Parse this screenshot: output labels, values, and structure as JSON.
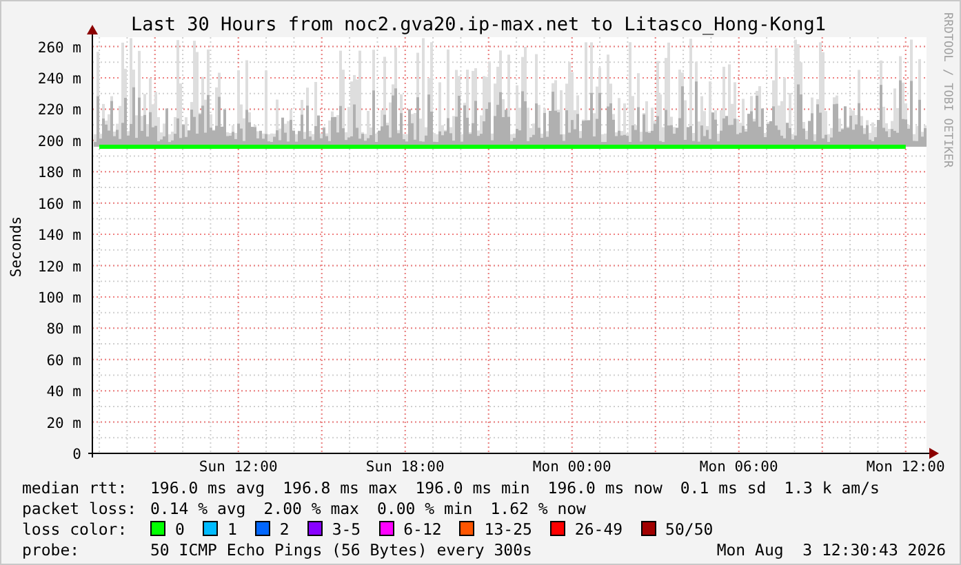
{
  "chart": {
    "title": "Last 30 Hours from noc2.gva20.ip-max.net to Litasco_Hong-Kong1",
    "watermark": "RRDTOOL / TOBI OETIKER",
    "chart_data": {
      "type": "line",
      "ylabel": "Seconds",
      "ylim": [
        0,
        266
      ],
      "grid": true,
      "categories": [
        null,
        null,
        null,
        null,
        null,
        "Sun 12:00",
        null,
        null,
        null,
        null,
        null,
        "Sun 18:00",
        null,
        null,
        null,
        null,
        null,
        "Mon 00:00",
        null,
        null,
        null,
        null,
        null,
        "Mon 06:00",
        null,
        null,
        null,
        null,
        null,
        "Mon 12:00"
      ],
      "yticks": [
        {
          "value": 0,
          "label": "0"
        },
        {
          "value": 20,
          "label": "20 m"
        },
        {
          "value": 40,
          "label": "40 m"
        },
        {
          "value": 60,
          "label": "60 m"
        },
        {
          "value": 80,
          "label": "80 m"
        },
        {
          "value": 100,
          "label": "100 m"
        },
        {
          "value": 120,
          "label": "120 m"
        },
        {
          "value": 140,
          "label": "140 m"
        },
        {
          "value": 160,
          "label": "160 m"
        },
        {
          "value": 180,
          "label": "180 m"
        },
        {
          "value": 200,
          "label": "200 m"
        },
        {
          "value": 220,
          "label": "220 m"
        },
        {
          "value": 240,
          "label": "240 m"
        },
        {
          "value": 260,
          "label": "260 m"
        }
      ],
      "series": [
        {
          "color": "#00ff00",
          "values": [
            196,
            196,
            196,
            196,
            196,
            196,
            196,
            196,
            196,
            196,
            196,
            196,
            196,
            196,
            196,
            196,
            196,
            196,
            196,
            196,
            196,
            196,
            196,
            196,
            196,
            196,
            196,
            196,
            196,
            196
          ]
        }
      ]
    }
  },
  "legend": {
    "median_rtt": {
      "label": "median rtt:",
      "values": [
        "196.0 ms avg",
        "196.8 ms max",
        "196.0 ms min",
        "196.0 ms now",
        "0.1 ms sd",
        "1.3 k am/s"
      ]
    },
    "packet_loss": {
      "label": "packet loss:",
      "values": [
        "0.14 % avg",
        "2.00 % max",
        "0.00 % min",
        "1.62 % now"
      ]
    },
    "loss_color": {
      "label": "loss color:",
      "items": [
        {
          "label": "0",
          "color": "#00ff00"
        },
        {
          "label": "1",
          "color": "#00bbff"
        },
        {
          "label": "2",
          "color": "#0066ff"
        },
        {
          "label": "3-5",
          "color": "#8800ff"
        },
        {
          "label": "6-12",
          "color": "#ff00ff"
        },
        {
          "label": "13-25",
          "color": "#ff5500"
        },
        {
          "label": "26-49",
          "color": "#ff0000"
        },
        {
          "label": "50/50",
          "color": "#a10000"
        }
      ]
    },
    "probe": {
      "label": "probe:",
      "text": "50 ICMP Echo Pings (56 Bytes) every 300s",
      "timestamp": "Mon Aug  3 12:30:43 2026"
    }
  }
}
